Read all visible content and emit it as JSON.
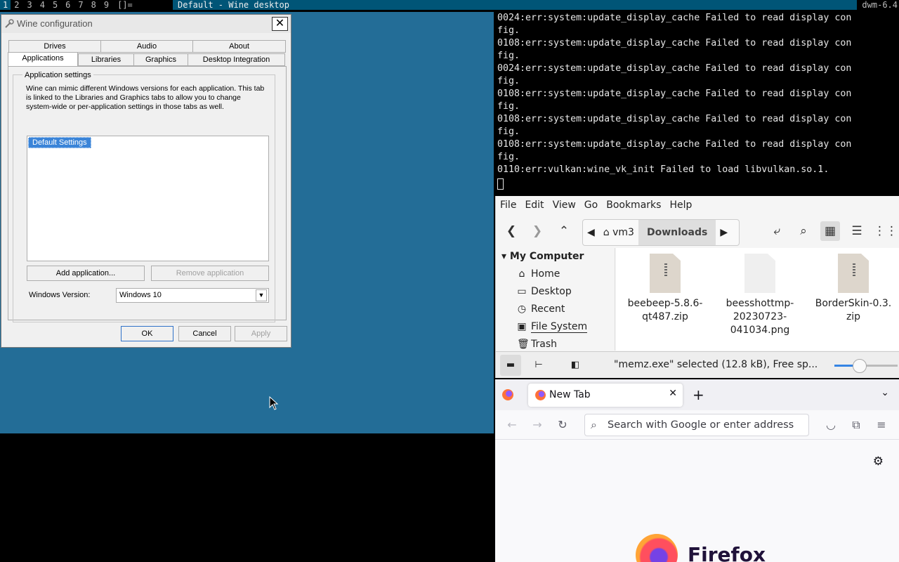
{
  "bar": {
    "tags": [
      "1",
      "2",
      "3",
      "4",
      "5",
      "6",
      "7",
      "8",
      "9"
    ],
    "selected_tag": "1",
    "layout": "[]=",
    "title": "Default - Wine desktop",
    "status": "dwm-6.4"
  },
  "winecfg": {
    "title": "Wine configuration",
    "close_label": "✕",
    "tabs_back": [
      "Drives",
      "Audio",
      "About"
    ],
    "tabs_front": [
      "Applications",
      "Libraries",
      "Graphics",
      "Desktop Integration"
    ],
    "active_tab": "Applications",
    "group_label": "Application settings",
    "description": "Wine can mimic different Windows versions for each application. This tab is linked to the Libraries and Graphics tabs to allow you to change system-wide or per-application settings in those tabs as well.",
    "list_items": [
      "Default Settings"
    ],
    "add_button": "Add application...",
    "remove_button": "Remove application",
    "winver_label": "Windows Version:",
    "winver_value": "Windows 10",
    "ok_button": "OK",
    "cancel_button": "Cancel",
    "apply_button": "Apply"
  },
  "terminal": {
    "lines": [
      "0024:err:system:update_display_cache Failed to read display con",
      "fig.",
      "0108:err:system:update_display_cache Failed to read display con",
      "fig.",
      "0024:err:system:update_display_cache Failed to read display con",
      "fig.",
      "0108:err:system:update_display_cache Failed to read display con",
      "fig.",
      "0108:err:system:update_display_cache Failed to read display con",
      "fig.",
      "0108:err:system:update_display_cache Failed to read display con",
      "fig.",
      "0110:err:vulkan:wine_vk_init Failed to load libvulkan.so.1."
    ]
  },
  "file_manager": {
    "menu": [
      "File",
      "Edit",
      "View",
      "Go",
      "Bookmarks",
      "Help"
    ],
    "path": {
      "home": "vm3",
      "current": "Downloads"
    },
    "sidebar_heading": "My Computer",
    "sidebar_items": [
      {
        "label": "Home",
        "icon": "home-icon"
      },
      {
        "label": "Desktop",
        "icon": "folder-icon"
      },
      {
        "label": "Recent",
        "icon": "clock-icon"
      },
      {
        "label": "File System",
        "icon": "drive-icon"
      },
      {
        "label": "Trash",
        "icon": "trash-icon"
      }
    ],
    "files": [
      {
        "name": "beebeep-5.8.6-qt487.zip",
        "lines": [
          "beebeep-5.8.6-",
          "qt487.zip"
        ],
        "kind": "zip"
      },
      {
        "name": "beesshottmp-20230723-041034.png",
        "lines": [
          "beesshottmp-",
          "20230723-",
          "041034.png"
        ],
        "kind": "image"
      },
      {
        "name": "BorderSkin-0.3.zip",
        "lines": [
          "BorderSkin-0.3.",
          "zip"
        ],
        "kind": "zip"
      }
    ],
    "status": "\"memz.exe\" selected (12.8 kB), Free sp...",
    "zoom_level": 0.4
  },
  "firefox": {
    "tab_title": "New Tab",
    "url_placeholder": "Search with Google or enter address",
    "brand": "Firefox"
  },
  "colors": {
    "wine_desktop": "#236d97",
    "dwm_selected": "#005577",
    "accent": "#3584e4"
  }
}
